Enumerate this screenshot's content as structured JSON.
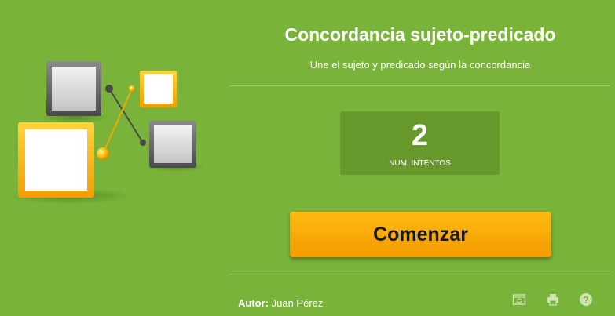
{
  "header": {
    "title": "Concordancia sujeto-predicado",
    "subtitle": "Une el sujeto y predicado según la concordancia"
  },
  "attempts": {
    "value": "2",
    "label": "NUM. INTENTOS"
  },
  "start_button": {
    "label": "Comenzar"
  },
  "footer": {
    "author_label": "Autor:",
    "author_name": "Juan Pérez",
    "icons": [
      "fullscreen-icon",
      "print-icon",
      "help-icon"
    ]
  },
  "colors": {
    "background": "#7ab33a",
    "panel": "#67992d",
    "button": "#f8a800",
    "divider": "#a3cb72"
  }
}
